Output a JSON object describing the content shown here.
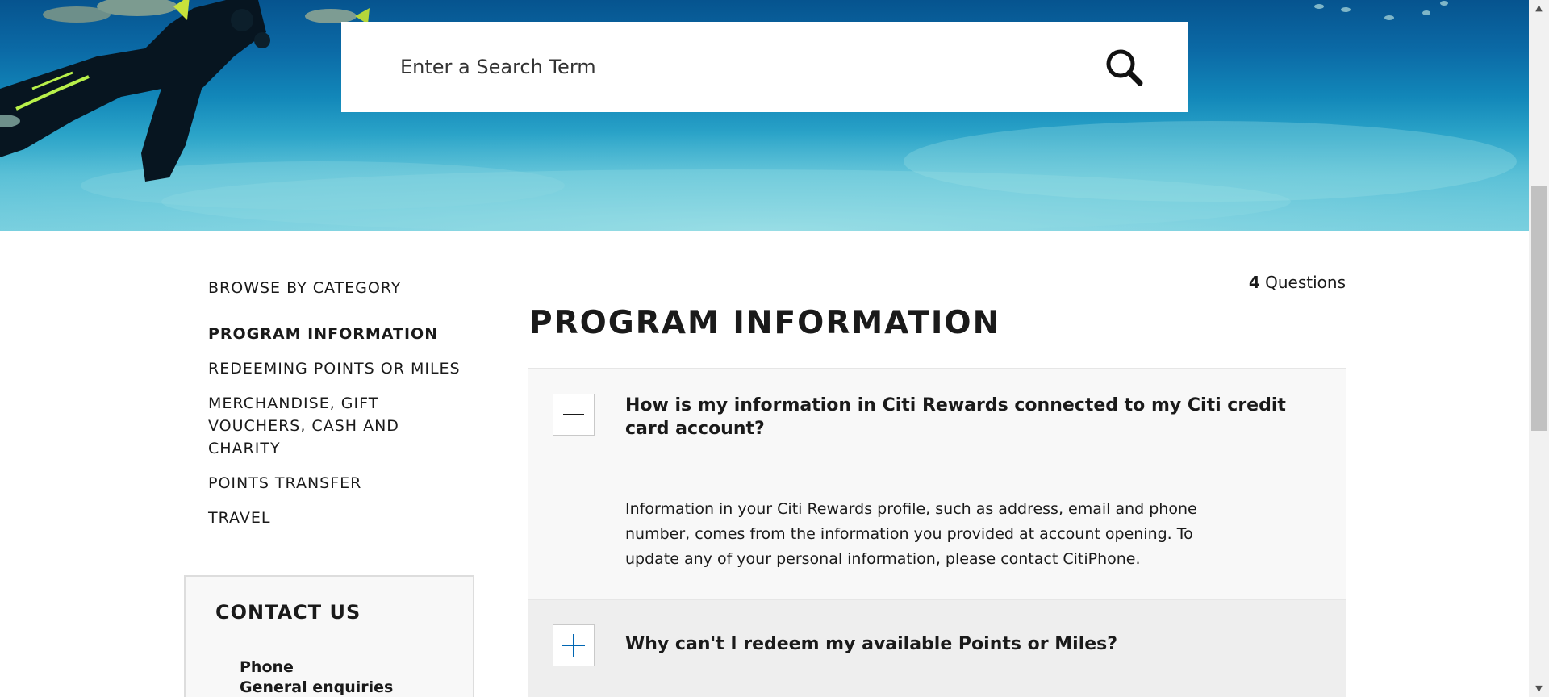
{
  "search": {
    "placeholder": "Enter a Search Term",
    "icon": "search-icon"
  },
  "sidebar": {
    "title": "BROWSE BY CATEGORY",
    "items": [
      {
        "label": "PROGRAM INFORMATION",
        "active": true
      },
      {
        "label": "REDEEMING POINTS OR MILES",
        "active": false
      },
      {
        "label": "MERCHANDISE, GIFT VOUCHERS, CASH AND CHARITY",
        "active": false
      },
      {
        "label": "POINTS TRANSFER",
        "active": false
      },
      {
        "label": "TRAVEL",
        "active": false
      }
    ]
  },
  "contact": {
    "title": "CONTACT US",
    "phone_label": "Phone",
    "phone_sub": "General enquiries"
  },
  "main": {
    "count": "4",
    "count_label": "Questions",
    "title": "PROGRAM INFORMATION",
    "faqs": [
      {
        "question": "How is my information in Citi Rewards connected to my Citi credit card account?",
        "answer": "Information in your Citi Rewards profile, such as address, email and phone number, comes from the information you provided at account opening. To update any of your personal information, please contact CitiPhone.",
        "expanded": true,
        "toggle_icon": "minus-icon"
      },
      {
        "question": "Why can't I redeem my available Points or Miles?",
        "expanded": false,
        "toggle_icon": "plus-icon"
      }
    ]
  },
  "colors": {
    "accent": "#0066b3",
    "text": "#1a1a1a",
    "open_bg": "#f8f8f8",
    "closed_bg": "#eeeeee"
  }
}
